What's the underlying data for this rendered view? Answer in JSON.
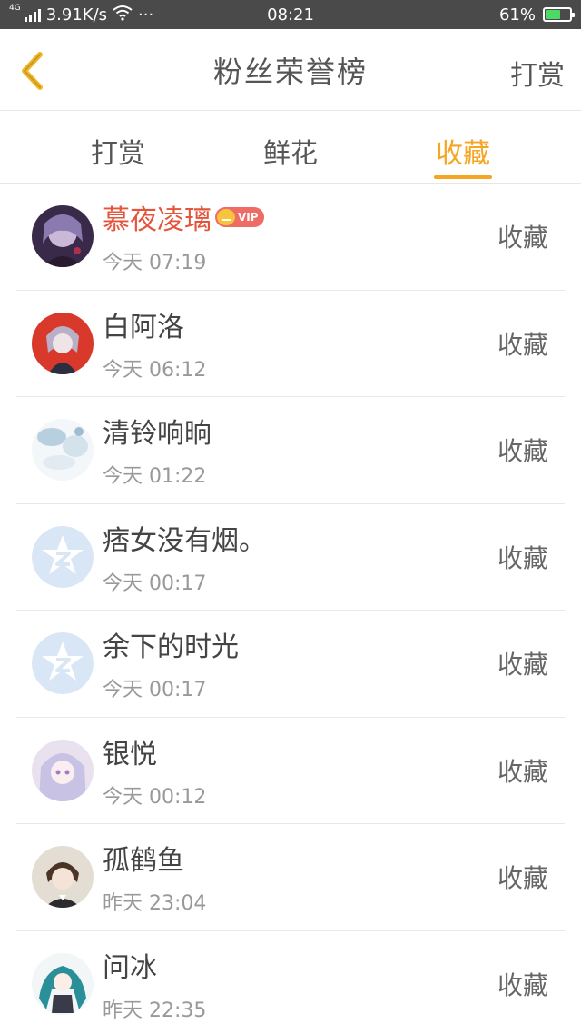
{
  "status_bar": {
    "net_type": "4G",
    "speed": "3.91K/s",
    "more": "···",
    "time": "08:21",
    "battery": "61%",
    "battery_level": 0.61
  },
  "header": {
    "title": "粉丝荣誉榜",
    "action": "打赏",
    "back_icon": "chevron-left-icon"
  },
  "tabs": [
    {
      "label": "打赏",
      "active": false
    },
    {
      "label": "鲜花",
      "active": false
    },
    {
      "label": "收藏",
      "active": true
    }
  ],
  "fans": [
    {
      "name": "慕夜凌璃",
      "vip": true,
      "vip_label": "VIP",
      "time": "今天 07:19",
      "action": "收藏"
    },
    {
      "name": "白阿洛",
      "vip": false,
      "time": "今天 06:12",
      "action": "收藏"
    },
    {
      "name": "清铃响晌",
      "vip": false,
      "time": "今天 01:22",
      "action": "收藏"
    },
    {
      "name": "痞女没有烟。",
      "vip": false,
      "time": "今天 00:17",
      "action": "收藏"
    },
    {
      "name": "余下的时光",
      "vip": false,
      "time": "今天 00:17",
      "action": "收藏"
    },
    {
      "name": "银悦",
      "vip": false,
      "time": "今天 00:12",
      "action": "收藏"
    },
    {
      "name": "孤鹤鱼",
      "vip": false,
      "time": "昨天 23:04",
      "action": "收藏"
    },
    {
      "name": "问冰",
      "vip": false,
      "time": "昨天 22:35",
      "action": "收藏"
    }
  ],
  "colors": {
    "accent": "#f5a623",
    "vip_name": "#e4553b"
  }
}
